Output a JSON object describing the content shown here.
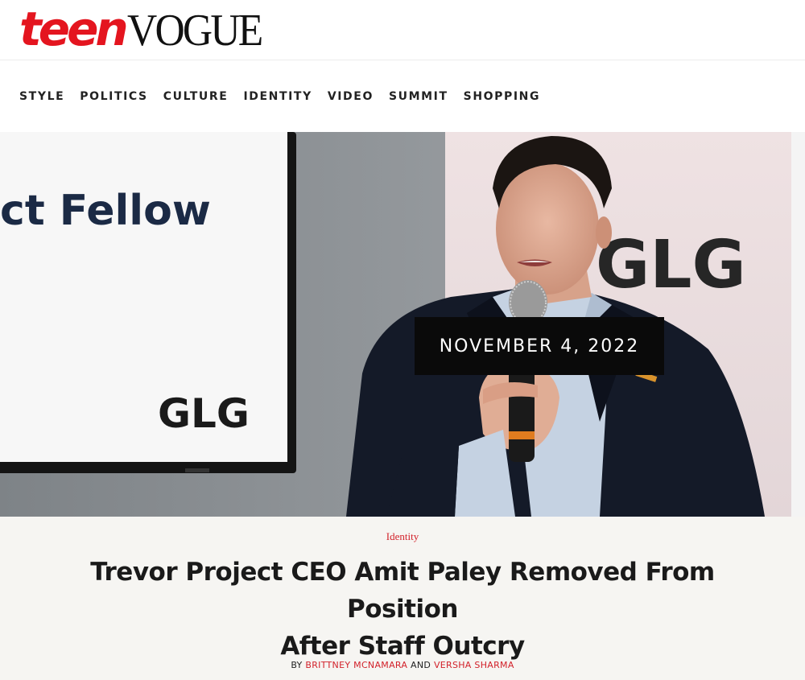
{
  "brand": {
    "logo_teen": "teen",
    "logo_vogue": "VOGUE",
    "accent_color": "#e4151f"
  },
  "nav": {
    "items": [
      "STYLE",
      "POLITICS",
      "CULTURE",
      "IDENTITY",
      "VIDEO",
      "SUMMIT",
      "SHOPPING"
    ]
  },
  "hero": {
    "screen_text": "ct Fellow",
    "screen_logo": "GLG",
    "backdrop_logo": "GLG",
    "date": "NOVEMBER 4, 2022"
  },
  "article": {
    "rubric": "Identity",
    "headline_line1": "Trevor Project CEO Amit Paley Removed From Position",
    "headline_line2": "After Staff Outcry",
    "byline_prefix": "BY",
    "author1": "BRITTNEY MCNAMARA",
    "byline_and": "AND",
    "author2": "VERSHA SHARMA"
  }
}
